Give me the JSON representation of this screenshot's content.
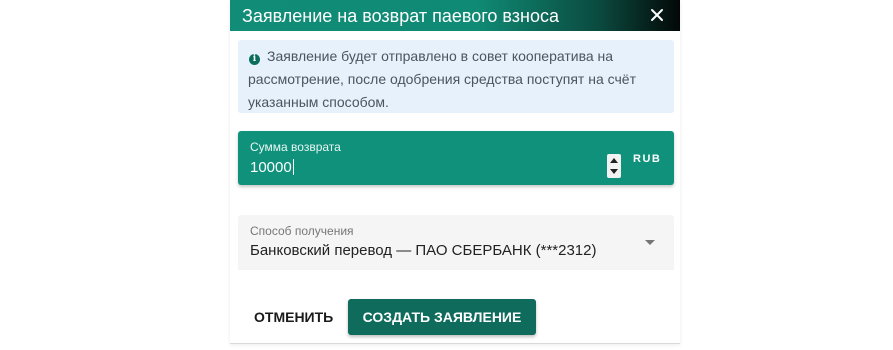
{
  "dialog": {
    "title": "Заявление на возврат паевого взноса",
    "close_icon": "close-icon"
  },
  "info": {
    "icon": "info-icon",
    "text": "Заявление будет отправлено в совет кооператива на рассмотрение, после одобрения средства поступят на счёт указанным способом."
  },
  "amount": {
    "label": "Сумма возврата",
    "value": "10000",
    "unit": "RUB"
  },
  "method": {
    "label": "Способ получения",
    "value": "Банковский перевод — ПАО СБЕРБАНК (***2312)"
  },
  "actions": {
    "cancel_label": "ОТМЕНИТЬ",
    "create_label": "СОЗДАТЬ ЗАЯВЛЕНИЕ"
  },
  "colors": {
    "accent": "#0f917b",
    "primary_button": "#0f6b5c",
    "info_background": "#e6f1fb"
  }
}
